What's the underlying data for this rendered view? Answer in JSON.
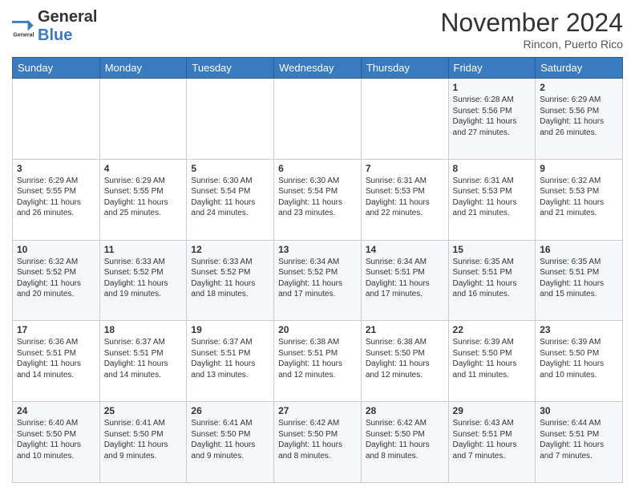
{
  "logo": {
    "general": "General",
    "blue": "Blue"
  },
  "header": {
    "month": "November 2024",
    "location": "Rincon, Puerto Rico"
  },
  "weekdays": [
    "Sunday",
    "Monday",
    "Tuesday",
    "Wednesday",
    "Thursday",
    "Friday",
    "Saturday"
  ],
  "weeks": [
    [
      {
        "day": "",
        "text": ""
      },
      {
        "day": "",
        "text": ""
      },
      {
        "day": "",
        "text": ""
      },
      {
        "day": "",
        "text": ""
      },
      {
        "day": "",
        "text": ""
      },
      {
        "day": "1",
        "text": "Sunrise: 6:28 AM\nSunset: 5:56 PM\nDaylight: 11 hours\nand 27 minutes."
      },
      {
        "day": "2",
        "text": "Sunrise: 6:29 AM\nSunset: 5:56 PM\nDaylight: 11 hours\nand 26 minutes."
      }
    ],
    [
      {
        "day": "3",
        "text": "Sunrise: 6:29 AM\nSunset: 5:55 PM\nDaylight: 11 hours\nand 26 minutes."
      },
      {
        "day": "4",
        "text": "Sunrise: 6:29 AM\nSunset: 5:55 PM\nDaylight: 11 hours\nand 25 minutes."
      },
      {
        "day": "5",
        "text": "Sunrise: 6:30 AM\nSunset: 5:54 PM\nDaylight: 11 hours\nand 24 minutes."
      },
      {
        "day": "6",
        "text": "Sunrise: 6:30 AM\nSunset: 5:54 PM\nDaylight: 11 hours\nand 23 minutes."
      },
      {
        "day": "7",
        "text": "Sunrise: 6:31 AM\nSunset: 5:53 PM\nDaylight: 11 hours\nand 22 minutes."
      },
      {
        "day": "8",
        "text": "Sunrise: 6:31 AM\nSunset: 5:53 PM\nDaylight: 11 hours\nand 21 minutes."
      },
      {
        "day": "9",
        "text": "Sunrise: 6:32 AM\nSunset: 5:53 PM\nDaylight: 11 hours\nand 21 minutes."
      }
    ],
    [
      {
        "day": "10",
        "text": "Sunrise: 6:32 AM\nSunset: 5:52 PM\nDaylight: 11 hours\nand 20 minutes."
      },
      {
        "day": "11",
        "text": "Sunrise: 6:33 AM\nSunset: 5:52 PM\nDaylight: 11 hours\nand 19 minutes."
      },
      {
        "day": "12",
        "text": "Sunrise: 6:33 AM\nSunset: 5:52 PM\nDaylight: 11 hours\nand 18 minutes."
      },
      {
        "day": "13",
        "text": "Sunrise: 6:34 AM\nSunset: 5:52 PM\nDaylight: 11 hours\nand 17 minutes."
      },
      {
        "day": "14",
        "text": "Sunrise: 6:34 AM\nSunset: 5:51 PM\nDaylight: 11 hours\nand 17 minutes."
      },
      {
        "day": "15",
        "text": "Sunrise: 6:35 AM\nSunset: 5:51 PM\nDaylight: 11 hours\nand 16 minutes."
      },
      {
        "day": "16",
        "text": "Sunrise: 6:35 AM\nSunset: 5:51 PM\nDaylight: 11 hours\nand 15 minutes."
      }
    ],
    [
      {
        "day": "17",
        "text": "Sunrise: 6:36 AM\nSunset: 5:51 PM\nDaylight: 11 hours\nand 14 minutes."
      },
      {
        "day": "18",
        "text": "Sunrise: 6:37 AM\nSunset: 5:51 PM\nDaylight: 11 hours\nand 14 minutes."
      },
      {
        "day": "19",
        "text": "Sunrise: 6:37 AM\nSunset: 5:51 PM\nDaylight: 11 hours\nand 13 minutes."
      },
      {
        "day": "20",
        "text": "Sunrise: 6:38 AM\nSunset: 5:51 PM\nDaylight: 11 hours\nand 12 minutes."
      },
      {
        "day": "21",
        "text": "Sunrise: 6:38 AM\nSunset: 5:50 PM\nDaylight: 11 hours\nand 12 minutes."
      },
      {
        "day": "22",
        "text": "Sunrise: 6:39 AM\nSunset: 5:50 PM\nDaylight: 11 hours\nand 11 minutes."
      },
      {
        "day": "23",
        "text": "Sunrise: 6:39 AM\nSunset: 5:50 PM\nDaylight: 11 hours\nand 10 minutes."
      }
    ],
    [
      {
        "day": "24",
        "text": "Sunrise: 6:40 AM\nSunset: 5:50 PM\nDaylight: 11 hours\nand 10 minutes."
      },
      {
        "day": "25",
        "text": "Sunrise: 6:41 AM\nSunset: 5:50 PM\nDaylight: 11 hours\nand 9 minutes."
      },
      {
        "day": "26",
        "text": "Sunrise: 6:41 AM\nSunset: 5:50 PM\nDaylight: 11 hours\nand 9 minutes."
      },
      {
        "day": "27",
        "text": "Sunrise: 6:42 AM\nSunset: 5:50 PM\nDaylight: 11 hours\nand 8 minutes."
      },
      {
        "day": "28",
        "text": "Sunrise: 6:42 AM\nSunset: 5:50 PM\nDaylight: 11 hours\nand 8 minutes."
      },
      {
        "day": "29",
        "text": "Sunrise: 6:43 AM\nSunset: 5:51 PM\nDaylight: 11 hours\nand 7 minutes."
      },
      {
        "day": "30",
        "text": "Sunrise: 6:44 AM\nSunset: 5:51 PM\nDaylight: 11 hours\nand 7 minutes."
      }
    ]
  ]
}
